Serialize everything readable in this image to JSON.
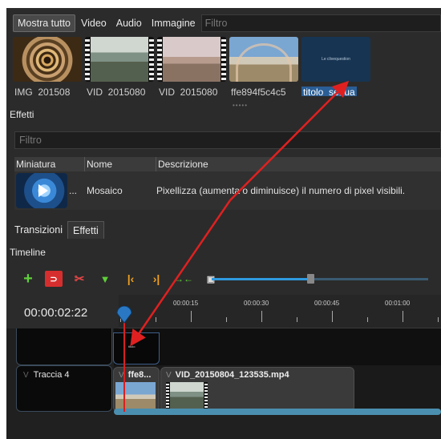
{
  "filters": {
    "buttons": [
      "Mostra tutto",
      "Video",
      "Audio",
      "Immagine"
    ],
    "active_index": 0,
    "search_placeholder": "Filtro"
  },
  "project_files": [
    {
      "name": "IMG_201508",
      "icon": "spiral-staircase-thumbnail"
    },
    {
      "name": "VID_2015080",
      "icon": "bridge-video-thumbnail"
    },
    {
      "name": "VID_2015080",
      "icon": "landscape-video-thumbnail"
    },
    {
      "name": "ffe894f5c4c5",
      "icon": "rainbow-image-thumbnail"
    },
    {
      "name": "titolo_segua",
      "icon": "title-card-thumbnail",
      "selected": true,
      "preview_text": "Le clivequestion"
    }
  ],
  "effects": {
    "title": "Effetti",
    "search_placeholder": "Filtro",
    "columns": [
      "Miniatura",
      "Nome",
      "Descrizione"
    ],
    "rows": [
      {
        "ellipsis": "...",
        "name": "Mosaico",
        "description": "Pixellizza (aumenta o diminuisce) il numero di pixel visibili."
      }
    ]
  },
  "tabs": [
    {
      "label": "Transizioni",
      "active": false
    },
    {
      "label": "Effetti",
      "active": true
    }
  ],
  "timeline": {
    "title": "Timeline",
    "timecode": "00:00:02:22",
    "ruler_labels": [
      "00:00:15",
      "00:00:30",
      "00:00:45",
      "00:01:00"
    ],
    "zoom_fraction": 0.44,
    "tracks": [
      {
        "name": "",
        "clips": [
          {
            "title": "",
            "preview_text": "titolo"
          }
        ]
      },
      {
        "name": "Traccia 4",
        "clips": [
          {
            "title": "ffe8..."
          },
          {
            "title": "VID_20150804_123535.mp4"
          }
        ]
      }
    ],
    "chevron": "V"
  },
  "colors": {
    "accent_blue": "#2f9ae0",
    "playhead_red": "#d92020",
    "annotation_red": "#e02020",
    "selection_blue": "#2a5e96"
  }
}
